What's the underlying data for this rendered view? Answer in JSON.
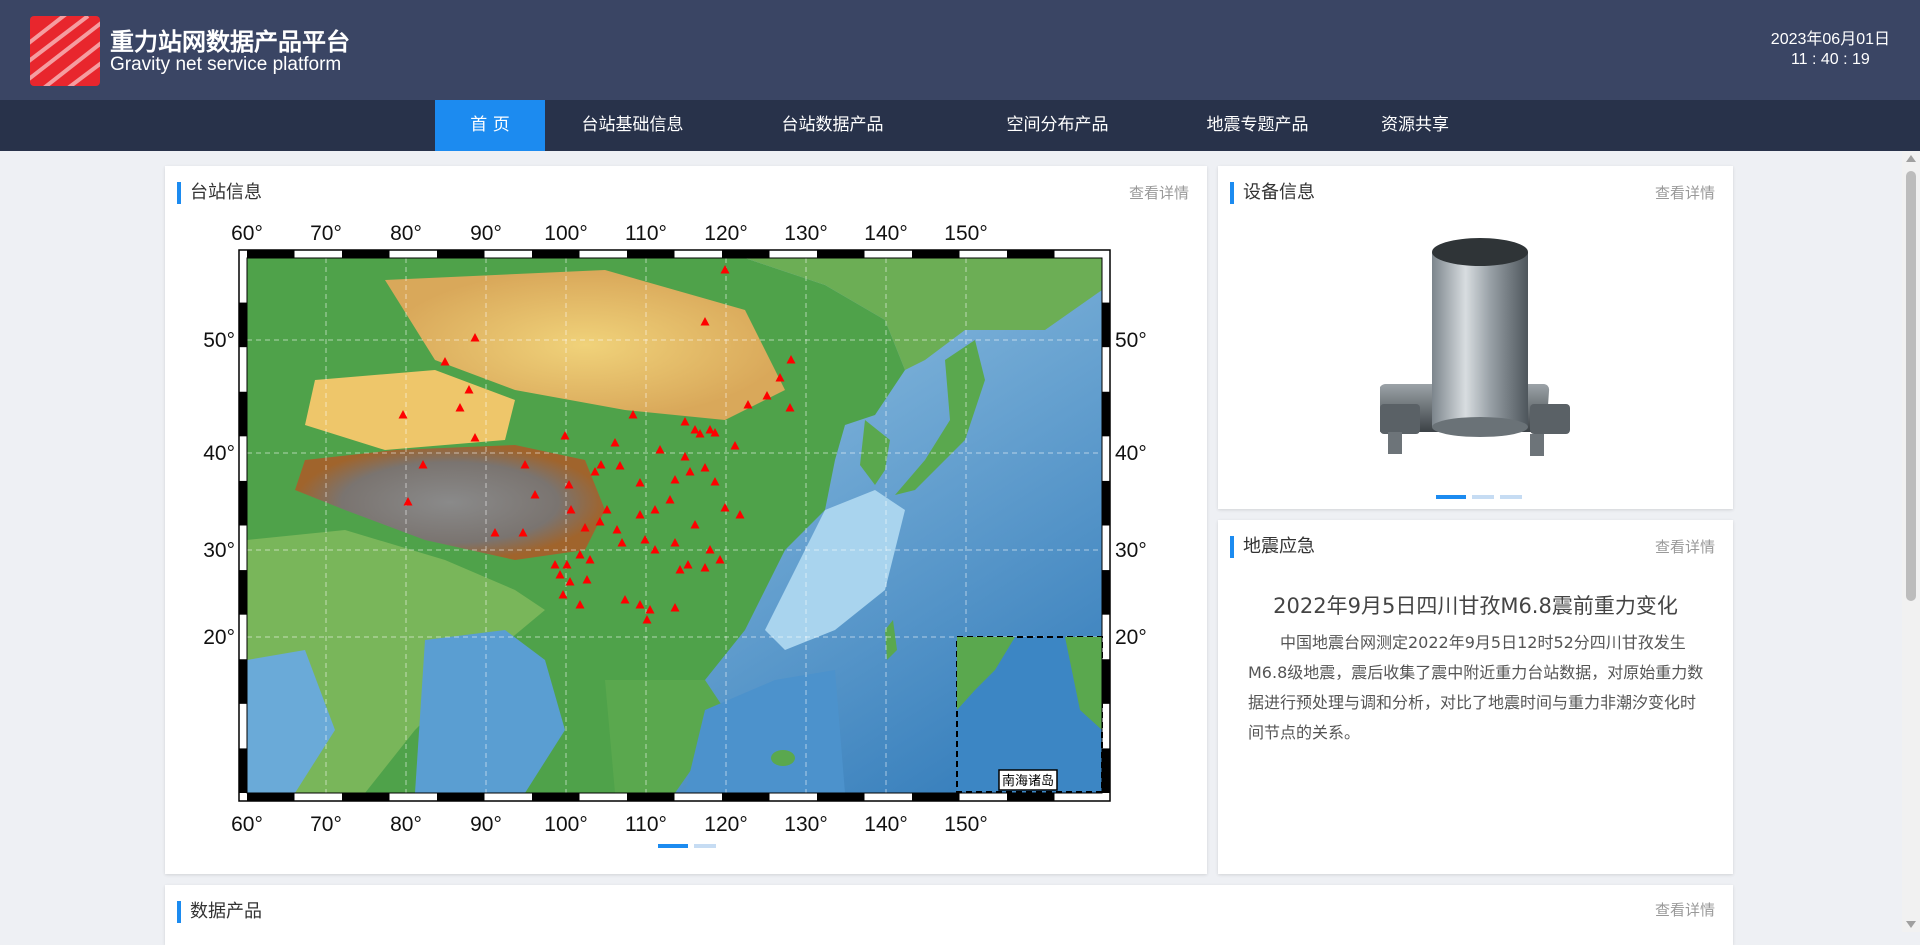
{
  "header": {
    "title_cn": "重力站网数据产品平台",
    "title_en": "Gravity net service platform",
    "date": "2023年06月01日",
    "time": "11 : 40 : 19",
    "logo_color": "#e8262d",
    "bg_color": "#3a4564"
  },
  "nav": {
    "items": [
      {
        "label": "首 页",
        "active": true
      },
      {
        "label": "台站基础信息"
      },
      {
        "label": "台站数据产品"
      },
      {
        "label": "空间分布产品"
      },
      {
        "label": "地震专题产品"
      },
      {
        "label": "资源共享"
      }
    ],
    "accent_color": "#1c8bf0"
  },
  "station_panel": {
    "title": "台站信息",
    "more": "查看详情",
    "map": {
      "lon_ticks": [
        "60°",
        "70°",
        "80°",
        "90°",
        "100°",
        "110°",
        "120°",
        "130°",
        "140°",
        "150°"
      ],
      "lat_ticks": [
        "50°",
        "40°",
        "30°",
        "20°"
      ],
      "inset_label": "南海诸岛",
      "marker": "red-triangle"
    },
    "carousel": {
      "count": 2,
      "active": 0
    }
  },
  "device_panel": {
    "title": "设备信息",
    "more": "查看详情",
    "carousel": {
      "count": 3,
      "active": 0
    }
  },
  "quake_panel": {
    "title": "地震应急",
    "more": "查看详情",
    "headline": "2022年9月5日四川甘孜M6.8震前重力变化",
    "body": "中国地震台网测定2022年9月5日12时52分四川甘孜发生M6.8级地震，震后收集了震中附近重力台站数据，对原始重力数据进行预处理与调和分析，对比了地震时间与重力非潮汐变化时间节点的关系。"
  },
  "data_panel": {
    "title": "数据产品",
    "more": "查看详情"
  }
}
